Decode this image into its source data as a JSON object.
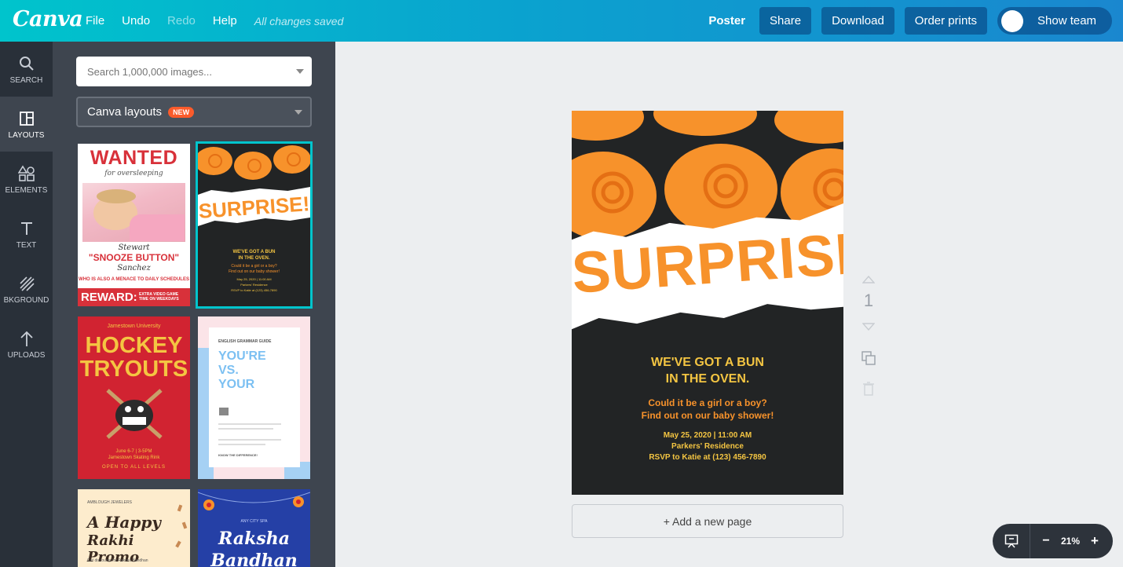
{
  "header": {
    "logo": "Canva",
    "menu": {
      "file": "File",
      "undo": "Undo",
      "redo": "Redo",
      "help": "Help",
      "saved_status": "All changes saved"
    },
    "doc_type": "Poster",
    "share_label": "Share",
    "download_label": "Download",
    "order_label": "Order prints",
    "team_label": "Show team"
  },
  "rail": {
    "items": [
      {
        "label": "SEARCH",
        "icon": "search-icon"
      },
      {
        "label": "LAYOUTS",
        "icon": "layouts-icon"
      },
      {
        "label": "ELEMENTS",
        "icon": "elements-icon"
      },
      {
        "label": "TEXT",
        "icon": "text-icon"
      },
      {
        "label": "BKGROUND",
        "icon": "background-icon"
      },
      {
        "label": "UPLOADS",
        "icon": "uploads-icon"
      }
    ]
  },
  "panel": {
    "search_placeholder": "Search 1,000,000 images...",
    "dropdown_label": "Canva layouts",
    "dropdown_badge": "NEW",
    "thumbs": {
      "wanted": {
        "title": "WANTED",
        "sub": "for oversleeping",
        "name1": "Stewart",
        "name2": "\"SNOOZE BUTTON\"",
        "name3": "Sanchez",
        "line": "WHO IS ALSO A MENACE TO DAILY SCHEDULES",
        "reward": "REWARD:",
        "reward_note": "EXTRA VIDEO GAME TIME ON WEEKDAYS"
      },
      "surprise": {
        "title": "SURPRISE!",
        "l1": "WE'VE GOT A BUN",
        "l2": "IN THE OVEN.",
        "l3": "Could it be a girl or a boy?",
        "l4": "Find out on our baby shower!",
        "l5": "May 25, 2020 | 11:00 AM",
        "l6": "Parkers' Residence",
        "l7": "RSVP to Katie at (123) 456-7890"
      },
      "hockey": {
        "school": "Jamestown University",
        "title1": "HOCKEY",
        "title2": "TRYOUTS",
        "date": "June 6-7 | 3-5PM",
        "place": "Jamestown Skating Rink",
        "open": "OPEN TO ALL LEVELS"
      },
      "grammar": {
        "kicker": "ENGLISH GRAMMAR GUIDE",
        "t1": "YOU'RE",
        "t2": "VS.",
        "t3": "YOUR",
        "cta": "KNOW THE DIFFERENCE!"
      },
      "rakhi": {
        "kicker": "AMBLOUGH JEWELERS",
        "t1": "A Happy",
        "t2": "Rakhi Promo",
        "note": "Get discounts for Raksha Bandhan"
      },
      "raksha": {
        "kicker": "ANY CITY SPA",
        "t1": "Raksha",
        "t2": "Bandhan"
      }
    }
  },
  "poster": {
    "title": "SURPRISE!",
    "line1": "WE'VE GOT A BUN",
    "line2": "IN THE OVEN.",
    "line3": "Could it be a girl or a boy?",
    "line4": "Find out on our baby shower!",
    "line5": "May 25, 2020 | 11:00 AM",
    "line6": "Parkers' Residence",
    "line7": "RSVP to Katie at (123) 456-7890"
  },
  "page_controls": {
    "page_number": "1"
  },
  "add_page_label": "+ Add a new page",
  "zoom": {
    "minus": "−",
    "value": "21%",
    "plus": "+"
  },
  "colors": {
    "accent": "#00c4cc",
    "orange": "#f7922b",
    "yellow": "#f4c542",
    "dark": "#222425"
  }
}
